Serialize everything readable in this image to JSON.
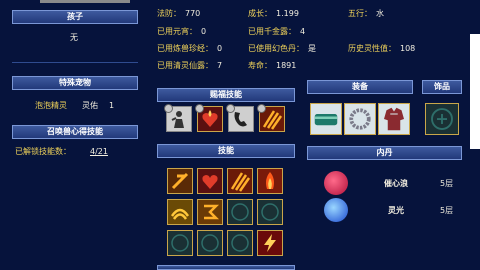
{
  "child": {
    "header": "孩子",
    "value": "无"
  },
  "special_pet": {
    "header": "特殊宠物",
    "name": "泡泡精灵",
    "skill": "灵佑",
    "count": "1"
  },
  "summon_skills": {
    "header": "召唤兽心得技能",
    "label": "已解锁技能数：",
    "value": "4/21"
  },
  "stats": {
    "magic_def": {
      "k": "法防：",
      "v": "770"
    },
    "growth": {
      "k": "成长：",
      "v": "1.199"
    },
    "element": {
      "k": "五行：",
      "v": "水"
    },
    "yuanxiao": {
      "k": "已用元宵：",
      "v": "0"
    },
    "qianjinlu": {
      "k": "已用千金露：",
      "v": "4"
    },
    "lianshou": {
      "k": "已用炼兽珍经：",
      "v": "0"
    },
    "huanse": {
      "k": "已使用幻色丹：",
      "v": "是"
    },
    "lingxing": {
      "k": "历史灵性值：",
      "v": "108"
    },
    "qinglinglu": {
      "k": "已用清灵仙露：",
      "v": "7"
    },
    "lifespan": {
      "k": "寿命：",
      "v": "1891"
    }
  },
  "sections": {
    "bound_skills": "赐福技能",
    "equipment": "装备",
    "accessory": "饰品",
    "skills": "技能",
    "neidan": "内丹"
  },
  "neidan": [
    {
      "name": "催心浪",
      "level": "5层"
    },
    {
      "name": "灵光",
      "level": "5层"
    }
  ],
  "icons": {
    "bound": [
      "shadow-figure-icon",
      "heart-flame-icon",
      "phone-claw-icon",
      "triple-claw-icon"
    ],
    "equip": [
      "jade-bracelet-icon",
      "pearl-necklace-icon",
      "armor-vest-icon"
    ],
    "skills": [
      "sword-slash-icon",
      "heart-flame-icon",
      "triple-claw-icon",
      "fire-burst-icon",
      "wind-swirl-icon",
      "rune-glyph-icon",
      "empty-slot",
      "empty-slot",
      "empty-slot",
      "empty-slot",
      "empty-slot",
      "lightning-icon"
    ]
  }
}
